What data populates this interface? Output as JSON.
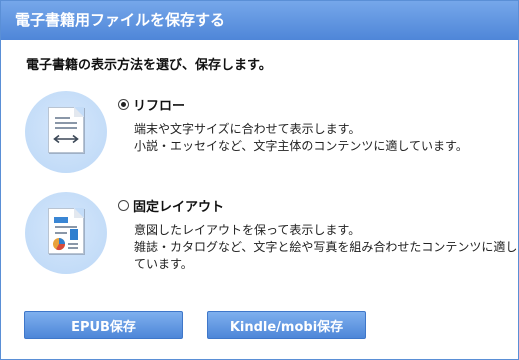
{
  "dialog": {
    "title": "電子書籍用ファイルを保存する",
    "instruction": "電子書籍の表示方法を選び、保存します。"
  },
  "options": [
    {
      "label": "リフロー",
      "selected": true,
      "icon": "reflow-document-icon",
      "description": [
        "端末や文字サイズに合わせて表示します。",
        "小説・エッセイなど、文字主体のコンテンツに適しています。"
      ]
    },
    {
      "label": "固定レイアウト",
      "selected": false,
      "icon": "fixed-layout-document-icon",
      "description": [
        "意図したレイアウトを保って表示します。",
        "雑誌・カタログなど、文字と絵や写真を組み合わせたコンテンツに適しています。"
      ]
    }
  ],
  "buttons": {
    "epub_label": "EPUB保存",
    "kindle_label": "Kindle/mobi保存"
  },
  "colors": {
    "titlebar": "#4f86d8",
    "button": "#4d86d8",
    "icon_circle": "#c3dcf8"
  }
}
